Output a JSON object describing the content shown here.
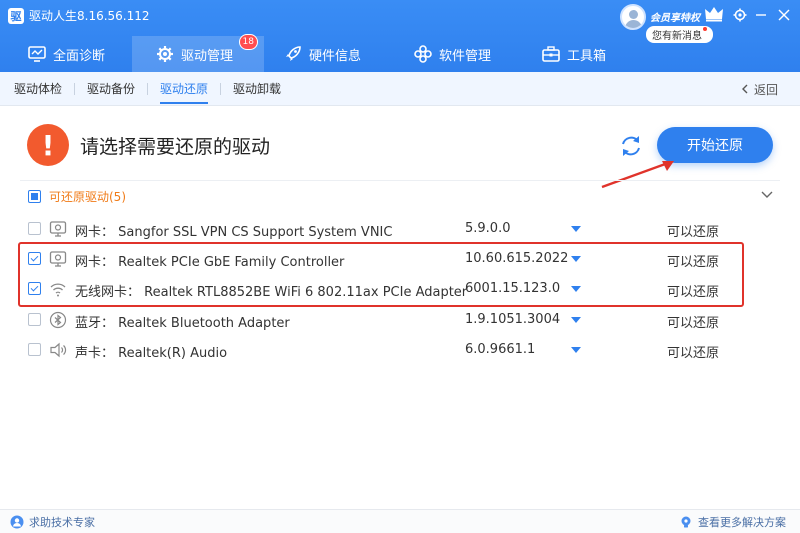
{
  "app": {
    "title": "驱动人生8.16.56.112",
    "logo_glyph": "驱"
  },
  "user": {
    "vip_label": "会员享特权",
    "message_label": "您有新消息"
  },
  "nav": {
    "tabs": [
      {
        "label": "全面诊断",
        "icon": "monitor-icon"
      },
      {
        "label": "驱动管理",
        "icon": "gear-icon",
        "badge": "18",
        "active": true
      },
      {
        "label": "硬件信息",
        "icon": "rocket-icon"
      },
      {
        "label": "软件管理",
        "icon": "apps-icon"
      },
      {
        "label": "工具箱",
        "icon": "toolbox-icon"
      }
    ]
  },
  "subnav": {
    "tabs": [
      "驱动体检",
      "驱动备份",
      "驱动还原",
      "驱动卸载"
    ],
    "active": "驱动还原",
    "back_label": "返回"
  },
  "header": {
    "warn_glyph": "!",
    "title": "请选择需要还原的驱动",
    "start_button": "开始还原"
  },
  "group": {
    "label": "可还原驱动(5)"
  },
  "drivers": [
    {
      "type": "网卡：",
      "name": "Sangfor SSL VPN CS Support System VNIC",
      "version": "5.9.0.0",
      "status": "可以还原",
      "checked": false,
      "icon": "network-card-icon"
    },
    {
      "type": "网卡：",
      "name": "Realtek PCIe GbE Family Controller",
      "version": "10.60.615.2022",
      "status": "可以还原",
      "checked": true,
      "icon": "network-card-icon"
    },
    {
      "type": "无线网卡：",
      "name": "Realtek RTL8852BE WiFi 6 802.11ax PCIe Adapter",
      "version": "6001.15.123.0",
      "status": "可以还原",
      "checked": true,
      "icon": "wifi-icon"
    },
    {
      "type": "蓝牙：",
      "name": "Realtek Bluetooth Adapter",
      "version": "1.9.1051.3004",
      "status": "可以还原",
      "checked": false,
      "icon": "bluetooth-icon"
    },
    {
      "type": "声卡：",
      "name": "Realtek(R) Audio",
      "version": "6.0.9661.1",
      "status": "可以还原",
      "checked": false,
      "icon": "speaker-icon"
    }
  ],
  "footer": {
    "left_label": "求助技术专家",
    "right_label": "查看更多解决方案"
  },
  "colors": {
    "primary": "#2f80ee",
    "warning": "#f25a2e",
    "group_label": "#f07c1a",
    "highlight": "#e0332b"
  }
}
